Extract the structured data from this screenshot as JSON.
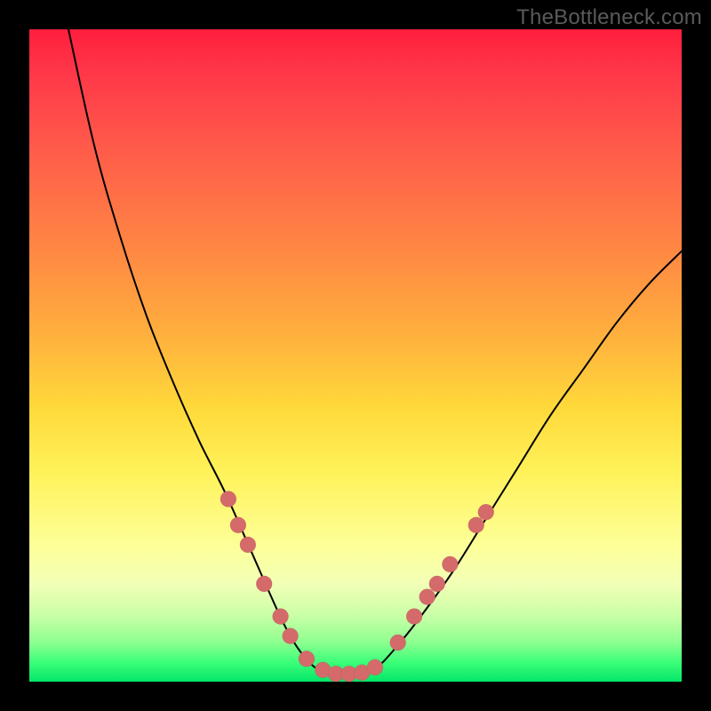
{
  "source_watermark": "TheBottleneck.com",
  "chart_data": {
    "type": "line",
    "title": "",
    "xlabel": "",
    "ylabel": "",
    "xlim": [
      0,
      100
    ],
    "ylim": [
      0,
      100
    ],
    "grid": false,
    "legend": null,
    "background_gradient": {
      "direction": "top-to-bottom",
      "stops": [
        {
          "pos": 0.0,
          "color": "#ff1e3c"
        },
        {
          "pos": 0.18,
          "color": "#ff5a4a"
        },
        {
          "pos": 0.46,
          "color": "#ffad3e"
        },
        {
          "pos": 0.68,
          "color": "#fff25a"
        },
        {
          "pos": 0.85,
          "color": "#f2ffb6"
        },
        {
          "pos": 1.0,
          "color": "#03e668"
        }
      ]
    },
    "series": [
      {
        "name": "bottleneck-curve",
        "color": "#000000",
        "x": [
          6,
          10,
          14,
          18,
          22,
          26,
          30,
          34,
          38,
          40,
          42,
          44,
          46,
          50,
          53,
          56,
          60,
          65,
          70,
          75,
          80,
          85,
          90,
          95,
          100
        ],
        "values": [
          100,
          82,
          68,
          56,
          46,
          37,
          29,
          20,
          11,
          7,
          4,
          2,
          1,
          1,
          2,
          5,
          10,
          17,
          25,
          33,
          41,
          48,
          55,
          61,
          66
        ]
      }
    ],
    "markers": {
      "name": "highlight-dots",
      "color": "#d46a6a",
      "points": [
        {
          "x": 30.5,
          "y": 28
        },
        {
          "x": 32.0,
          "y": 24
        },
        {
          "x": 33.5,
          "y": 21
        },
        {
          "x": 36.0,
          "y": 15
        },
        {
          "x": 38.5,
          "y": 10
        },
        {
          "x": 40.0,
          "y": 7
        },
        {
          "x": 42.5,
          "y": 3.5
        },
        {
          "x": 45.0,
          "y": 1.8
        },
        {
          "x": 47.0,
          "y": 1.2
        },
        {
          "x": 49.0,
          "y": 1.2
        },
        {
          "x": 51.0,
          "y": 1.4
        },
        {
          "x": 53.0,
          "y": 2.2
        },
        {
          "x": 56.5,
          "y": 6
        },
        {
          "x": 59.0,
          "y": 10
        },
        {
          "x": 61.0,
          "y": 13
        },
        {
          "x": 62.5,
          "y": 15
        },
        {
          "x": 64.5,
          "y": 18
        },
        {
          "x": 68.5,
          "y": 24
        },
        {
          "x": 70.0,
          "y": 26
        }
      ]
    }
  }
}
